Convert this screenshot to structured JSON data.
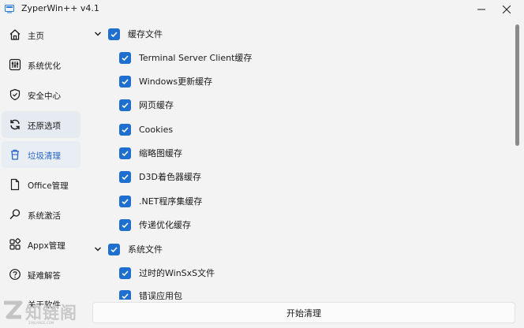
{
  "window": {
    "title": "ZyperWin++ v4.1",
    "minimize_icon": "minimize-icon",
    "close_icon": "close-icon"
  },
  "sidebar": {
    "items": [
      {
        "label": "主页",
        "icon": "home-icon"
      },
      {
        "label": "系统优化",
        "icon": "sliders-icon"
      },
      {
        "label": "安全中心",
        "icon": "shield-icon"
      },
      {
        "label": "还原选项",
        "icon": "refresh-icon"
      },
      {
        "label": "垃圾清理",
        "icon": "trash-icon"
      },
      {
        "label": "Office管理",
        "icon": "document-icon"
      },
      {
        "label": "系统激活",
        "icon": "search-key-icon"
      },
      {
        "label": "Appx管理",
        "icon": "apps-icon"
      },
      {
        "label": "疑难解答",
        "icon": "help-icon"
      },
      {
        "label": "关于软件",
        "icon": "info-icon"
      }
    ],
    "active_item": "垃圾清理"
  },
  "groups": [
    {
      "label": "缓存文件",
      "expanded": true,
      "checked": true,
      "items": [
        {
          "label": "Terminal Server Client缓存",
          "checked": true
        },
        {
          "label": "Windows更新缓存",
          "checked": true
        },
        {
          "label": "网页缓存",
          "checked": true
        },
        {
          "label": "Cookies",
          "checked": true
        },
        {
          "label": "缩略图缓存",
          "checked": true
        },
        {
          "label": "D3D着色器缓存",
          "checked": true
        },
        {
          "label": ".NET程序集缓存",
          "checked": true
        },
        {
          "label": "传递优化缓存",
          "checked": true
        }
      ]
    },
    {
      "label": "系统文件",
      "expanded": true,
      "checked": true,
      "items": [
        {
          "label": "过时的WinSxS文件",
          "checked": true
        },
        {
          "label": "错误应用包",
          "checked": true
        }
      ]
    }
  ],
  "actions": {
    "start_clean": "开始清理"
  },
  "watermark": {
    "text": "知链阁",
    "letter": "Z",
    "sub": "ZHILIANGE.COM"
  },
  "colors": {
    "accent": "#1f6fce",
    "active_nav_bg": "#e9eef5",
    "window_bg": "#f3f3f3"
  }
}
